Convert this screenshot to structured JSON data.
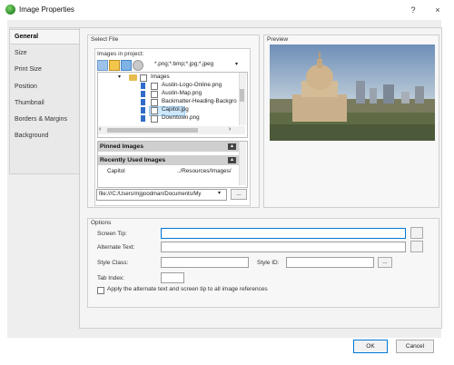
{
  "window": {
    "title": "Image Properties",
    "help_label": "?",
    "close_label": "×"
  },
  "nav": {
    "items": [
      {
        "label": "General"
      },
      {
        "label": "Size"
      },
      {
        "label": "Print Size"
      },
      {
        "label": "Position"
      },
      {
        "label": "Thumbnail"
      },
      {
        "label": "Borders & Margins"
      },
      {
        "label": "Background"
      }
    ]
  },
  "select_file": {
    "section_label": "Select File",
    "images_label": "Images in project:",
    "filter_value": "*.png;*.bmp;*.jpg;*.jpeg",
    "tree": {
      "folder": "Images",
      "files": [
        "Austin-Logo-Online.png",
        "Austin-Map.png",
        "Backmatter-Heading-Backgro",
        "Capitol.jpg",
        "Downtown.png"
      ],
      "selected": "Capitol.jpg"
    },
    "pinned_label": "Pinned Images",
    "recent_label": "Recently Used Images",
    "recent_items": [
      {
        "name": "Capitol",
        "path": "../Resources/Images/"
      }
    ],
    "path_value": "file:///C:/Users/mjgoodman/Documents/My",
    "browse_label": "..."
  },
  "preview": {
    "section_label": "Preview"
  },
  "options": {
    "section_label": "Options",
    "screen_tip_label": "Screen Tip:",
    "alt_text_label": "Alternate Text:",
    "style_class_label": "Style Class:",
    "style_id_label": "Style ID:",
    "style_id_btn": "...",
    "tab_index_label": "Tab Index:",
    "apply_label": "Apply the alternate text and screen tip to all image references"
  },
  "footer": {
    "ok_label": "OK",
    "cancel_label": "Cancel"
  },
  "colors": {
    "accent": "#0078d7",
    "selection": "#cce8ff",
    "folder": "#e8bb4f"
  }
}
